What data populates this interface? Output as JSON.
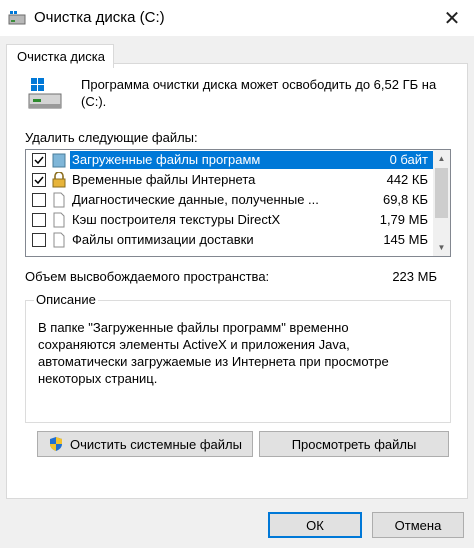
{
  "window": {
    "title": "Очистка диска  (C:)",
    "close_glyph": "✕"
  },
  "tabs": [
    {
      "label": "Очистка диска",
      "active": true
    }
  ],
  "intro": {
    "text": "Программа очистки диска может освободить до 6,52 ГБ на (C:)."
  },
  "files": {
    "label": "Удалить следующие файлы:",
    "items": [
      {
        "label": "Загруженные файлы программ",
        "size": "0 байт",
        "checked": true,
        "selected": true,
        "icon": "folder-icon"
      },
      {
        "label": "Временные файлы Интернета",
        "size": "442 КБ",
        "checked": true,
        "selected": false,
        "icon": "lock-icon"
      },
      {
        "label": "Диагностические данные, полученные ...",
        "size": "69,8 КБ",
        "checked": false,
        "selected": false,
        "icon": "file-icon"
      },
      {
        "label": "Кэш построителя текстуры DirectX",
        "size": "1,79 МБ",
        "checked": false,
        "selected": false,
        "icon": "file-icon"
      },
      {
        "label": "Файлы оптимизации доставки",
        "size": "145 МБ",
        "checked": false,
        "selected": false,
        "icon": "file-icon"
      }
    ]
  },
  "space": {
    "label": "Объем высвобождаемого пространства:",
    "value": "223 МБ"
  },
  "description": {
    "legend": "Описание",
    "text": "В папке \"Загруженные файлы программ\" временно сохраняются элементы ActiveX и приложения Java, автоматически загружаемые из Интернета при просмотре некоторых страниц."
  },
  "buttons": {
    "system_files": "Очистить системные файлы",
    "view_files": "Просмотреть файлы",
    "ok": "ОК",
    "cancel": "Отмена"
  },
  "colors": {
    "selection": "#0078d7",
    "background": "#f0f0f0"
  }
}
